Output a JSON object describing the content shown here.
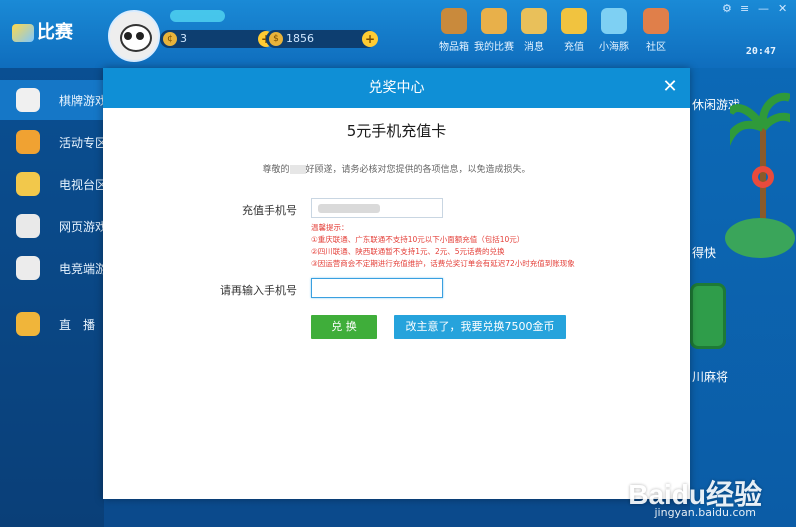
{
  "app": {
    "logo_text": "比赛",
    "coins": "3",
    "gold": "1856",
    "clock": "20:47",
    "top_nav": [
      {
        "label": "物品箱",
        "icon": "chest-icon",
        "color": "#c98a3c"
      },
      {
        "label": "我的比赛",
        "icon": "player-icon",
        "color": "#e8b04a"
      },
      {
        "label": "消息",
        "icon": "message-icon",
        "color": "#e9c05a"
      },
      {
        "label": "充值",
        "icon": "coin-icon",
        "color": "#f1c33f"
      },
      {
        "label": "小海豚",
        "icon": "dolphin-icon",
        "color": "#7ed0f3"
      },
      {
        "label": "社区",
        "icon": "community-icon",
        "color": "#e07f4a"
      }
    ],
    "sidebar": [
      {
        "label": "棋牌游戏",
        "icon": "spade-icon",
        "color": "#f0f0f0"
      },
      {
        "label": "活动专区",
        "icon": "gift-icon",
        "color": "#f0a232"
      },
      {
        "label": "电视台区",
        "icon": "tv-icon",
        "color": "#f2c84b"
      },
      {
        "label": "网页游戏",
        "icon": "shield-icon",
        "color": "#e9e9e9"
      },
      {
        "label": "电竞端游",
        "icon": "gamepad-icon",
        "color": "#ececec"
      },
      {
        "label": "直　播",
        "icon": "live-icon",
        "color": "#f0b53a"
      }
    ],
    "scene_labels": {
      "top": "休闲游戏",
      "mid": "得快",
      "bottom": "川麻将"
    }
  },
  "modal": {
    "header_title": "兑奖中心",
    "close_glyph": "✕",
    "card_title": "5元手机充值卡",
    "notice_before": "尊敬的",
    "notice_after": "好顾遂，请务必核对您提供的各项信息，以免造成损失。",
    "phone_label": "充值手机号",
    "confirm_label": "请再输入手机号",
    "confirm_value": "",
    "tips_title": "温馨提示：",
    "tips": [
      "①重庆联通、广东联通不支持10元以下小面额充值（包括10元）",
      "②四川联通、陕西联通暂不支持1元、2元、5元话费的兑换",
      "③因运营商会不定期进行充值维护，话费兑奖订单会有延迟72小时充值到账现象"
    ],
    "exchange_button": "兑 换",
    "alt_button": "改主意了，我要兑换7500金币"
  },
  "watermark": {
    "brand": "Baidu经验",
    "url": "jingyan.baidu.com"
  }
}
